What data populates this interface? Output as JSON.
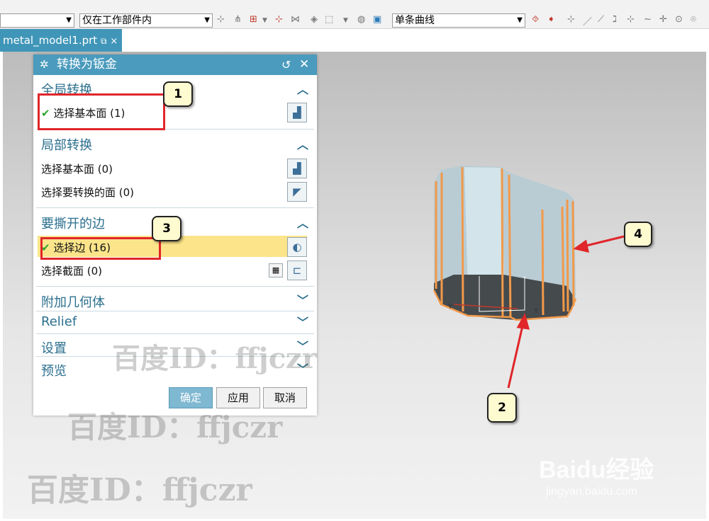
{
  "toolbar": {
    "filter_combo": "",
    "scope_combo": "仅在工作部件内",
    "curve_rule_combo": "单条曲线"
  },
  "tab": {
    "label": "metal_model1.prt",
    "close": "×"
  },
  "dialog": {
    "title": "转换为钣金",
    "sections": {
      "global": {
        "header": "全局转换",
        "row1": "选择基本面 (1)"
      },
      "local": {
        "header": "局部转换",
        "row1": "选择基本面 (0)",
        "row2": "选择要转换的面 (0)"
      },
      "rip": {
        "header": "要撕开的边",
        "row1": "选择边 (16)",
        "row2": "选择截面 (0)"
      },
      "extra": {
        "header": "附加几何体"
      },
      "relief": {
        "header": "Relief"
      },
      "settings": {
        "header": "设置"
      },
      "preview": {
        "header": "预览"
      }
    },
    "buttons": {
      "ok": "确定",
      "apply": "应用",
      "cancel": "取消"
    }
  },
  "callouts": {
    "c1": "1",
    "c2": "2",
    "c3": "3",
    "c4": "4"
  },
  "watermarks": {
    "id1": "百度ID：ffjczr",
    "id2": "百度ID：ffjczr",
    "id3": "百度ID：ffjczr"
  },
  "baidu": {
    "logo": "Baidu经验",
    "url": "jingyan.baidu.com"
  },
  "colors": {
    "title_bar": "#4a9bbd",
    "section_text": "#2b6f8e",
    "highlight": "#fbe48a",
    "red_box": "#e0262a"
  }
}
